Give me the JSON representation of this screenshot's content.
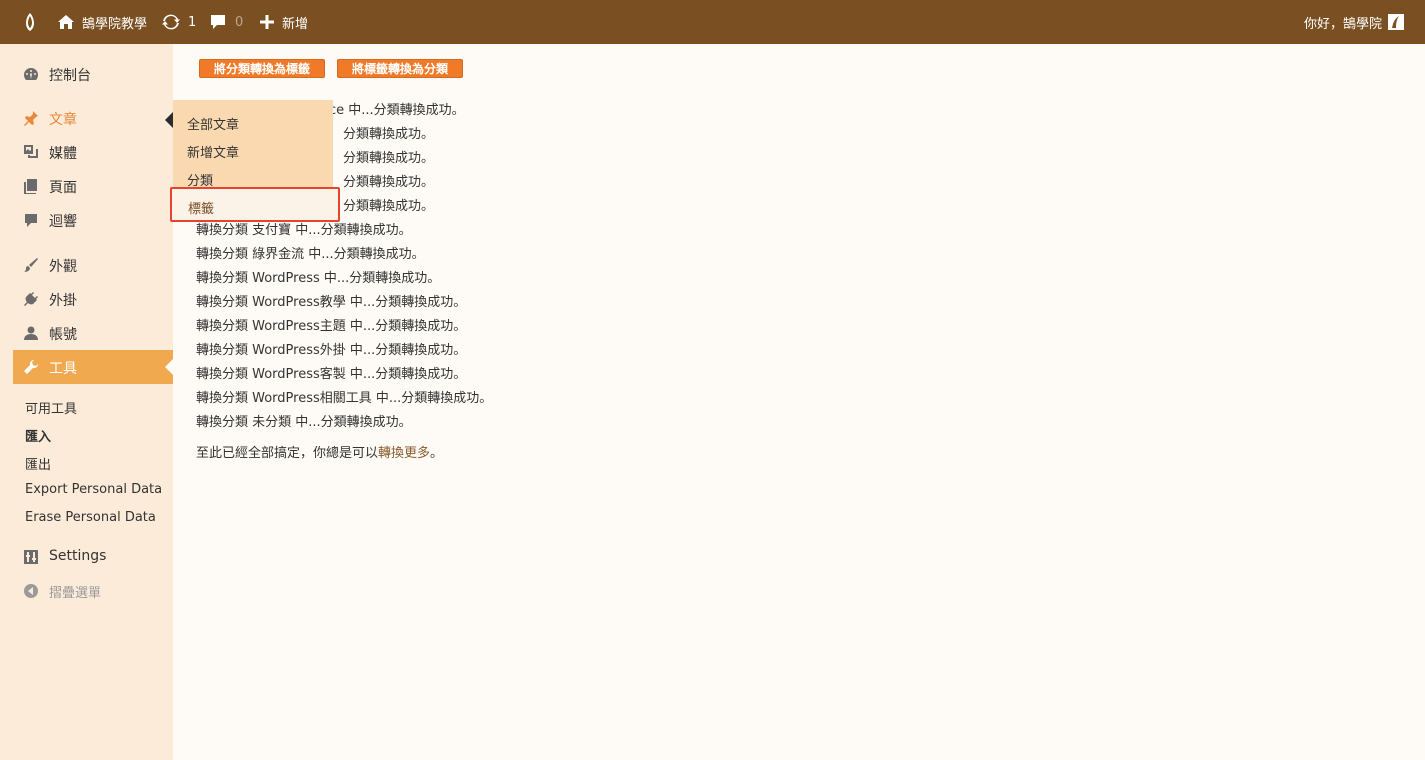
{
  "adminbar": {
    "logo_icon": "feather-logo-icon",
    "site_name": "鵠學院教學",
    "updates_count": "1",
    "comments_count": "0",
    "new_label": "新增",
    "greeting": "你好，鵠學院"
  },
  "sidebar": {
    "items": [
      {
        "label": "控制台",
        "icon": "dashboard-icon"
      },
      {
        "label": "文章",
        "icon": "pin-icon"
      },
      {
        "label": "媒體",
        "icon": "media-icon"
      },
      {
        "label": "頁面",
        "icon": "page-icon"
      },
      {
        "label": "迴響",
        "icon": "comment-icon"
      },
      {
        "label": "外觀",
        "icon": "brush-icon"
      },
      {
        "label": "外掛",
        "icon": "plugin-icon"
      },
      {
        "label": "帳號",
        "icon": "user-icon"
      },
      {
        "label": "工具",
        "icon": "wrench-icon"
      },
      {
        "label": "Settings",
        "icon": "settings-icon"
      },
      {
        "label": "摺疊選單",
        "icon": "collapse-icon"
      }
    ],
    "tools_sub": [
      "可用工具",
      "匯入",
      "匯出",
      "Export Personal Data",
      "Erase Personal Data"
    ]
  },
  "flyout": {
    "items": [
      "全部文章",
      "新增文章",
      "分類",
      "標籤"
    ]
  },
  "main": {
    "button_cat_to_tag": "將分類轉換為標籤",
    "button_tag_to_cat": "將標籤轉換為分類",
    "partial_lines": [
      "ce 中...分類轉換成功。",
      "分類轉換成功。",
      "分類轉換成功。",
      "分類轉換成功。",
      "分類轉換成功。"
    ],
    "lines": [
      "轉換分類 支付寶 中...分類轉換成功。",
      "轉換分類 綠界金流 中...分類轉換成功。",
      "轉換分類 WordPress 中...分類轉換成功。",
      "轉換分類 WordPress教學 中...分類轉換成功。",
      "轉換分類 WordPress主題 中...分類轉換成功。",
      "轉換分類 WordPress外掛 中...分類轉換成功。",
      "轉換分類 WordPress客製 中...分類轉換成功。",
      "轉換分類 WordPress相關工具 中...分類轉換成功。",
      "轉換分類 未分類 中...分類轉換成功。"
    ],
    "final_text": "至此已經全部搞定，你總是可以",
    "final_link": "轉換更多",
    "final_end": "。"
  },
  "colors": {
    "adminbar_bg": "#7a4f22",
    "sidebar_bg": "#fcebd9",
    "active_menu": "#f0a94e",
    "button_bg": "#f07a28",
    "highlight_border": "#e8432f"
  }
}
